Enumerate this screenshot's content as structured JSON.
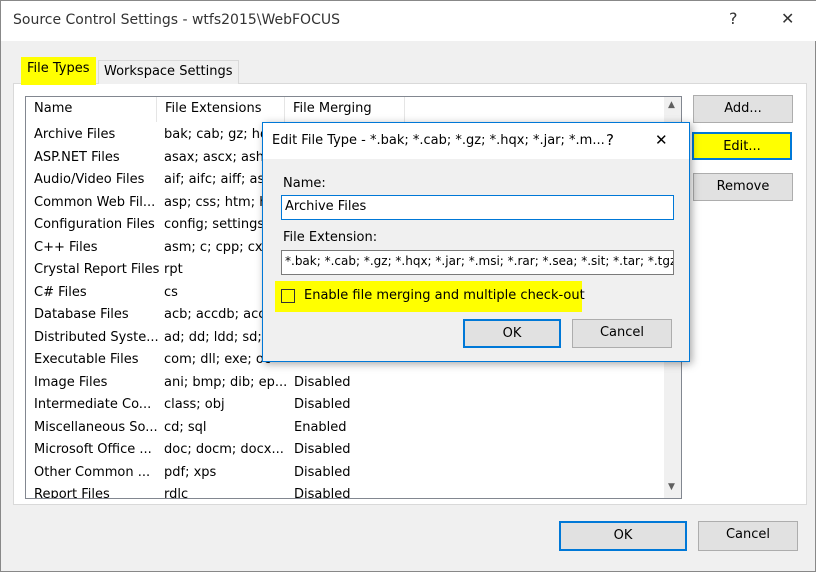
{
  "window": {
    "title": "Source Control Settings - wtfs2015\\WebFOCUS",
    "help": "?",
    "close": "✕"
  },
  "tabs": [
    {
      "label": "File Types",
      "selected": true
    },
    {
      "label": "Workspace Settings",
      "selected": false
    }
  ],
  "table": {
    "columns": [
      "Name",
      "File Extensions",
      "File Merging"
    ],
    "rows": [
      {
        "name": "Archive Files",
        "ext": "bak; cab; gz; hq",
        "merge": ""
      },
      {
        "name": "ASP.NET Files",
        "ext": "asax; ascx; ashx;",
        "merge": ""
      },
      {
        "name": "Audio/Video Files",
        "ext": "aif; aifc; aiff; asf;",
        "merge": ""
      },
      {
        "name": "Common Web Fil...",
        "ext": "asp; css; htm; ht",
        "merge": ""
      },
      {
        "name": "Configuration Files",
        "ext": "config; settings",
        "merge": ""
      },
      {
        "name": "C++ Files",
        "ext": "asm; c; cpp; cxx",
        "merge": ""
      },
      {
        "name": "Crystal Report Files",
        "ext": "rpt",
        "merge": ""
      },
      {
        "name": "C# Files",
        "ext": "cs",
        "merge": ""
      },
      {
        "name": "Database Files",
        "ext": "acb; accdb; acc",
        "merge": ""
      },
      {
        "name": "Distributed Syste...",
        "ext": "ad; dd; ldd; sd; s",
        "merge": ""
      },
      {
        "name": "Executable Files",
        "ext": "com; dll; exe; oc",
        "merge": ""
      },
      {
        "name": "Image Files",
        "ext": "ani; bmp; dib; ep...",
        "merge": "Disabled"
      },
      {
        "name": "Intermediate Co...",
        "ext": "class; obj",
        "merge": "Disabled"
      },
      {
        "name": "Miscellaneous So...",
        "ext": "cd; sql",
        "merge": "Enabled"
      },
      {
        "name": "Microsoft Office ...",
        "ext": "doc; docm; docx...",
        "merge": "Disabled"
      },
      {
        "name": "Other Common ...",
        "ext": "pdf; xps",
        "merge": "Disabled"
      },
      {
        "name": "Report Files",
        "ext": "rdlc",
        "merge": "Disabled"
      }
    ]
  },
  "side_buttons": {
    "add": "Add...",
    "edit": "Edit...",
    "remove": "Remove"
  },
  "footer": {
    "ok": "OK",
    "cancel": "Cancel"
  },
  "dialog": {
    "title": "Edit File Type - *.bak; *.cab; *.gz; *.hqx; *.jar; *.m...",
    "help": "?",
    "close": "✕",
    "name_label": "Name:",
    "name_value": "Archive Files",
    "ext_label": "File Extension:",
    "ext_value": "*.bak; *.cab; *.gz; *.hqx; *.jar; *.msi; *.rar; *.sea; *.sit; *.tar; *.tgz;",
    "checkbox_label": "Enable file merging and multiple check-out",
    "checkbox_checked": false,
    "ok": "OK",
    "cancel": "Cancel"
  },
  "colors": {
    "highlight": "#ffff00",
    "accent": "#0078d7"
  }
}
